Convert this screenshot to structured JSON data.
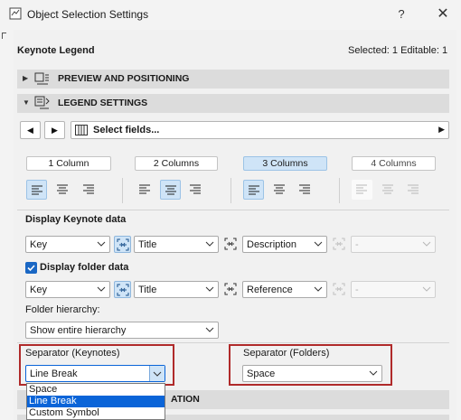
{
  "window": {
    "title": "Object Selection Settings",
    "help_label": "?",
    "close_label": "✕"
  },
  "header": {
    "object_name": "Keynote Legend",
    "selection_info": "Selected: 1 Editable: 1"
  },
  "sections": {
    "preview": "PREVIEW AND POSITIONING",
    "legend": "LEGEND SETTINGS",
    "hidden_partial": "ATION"
  },
  "toolbar": {
    "select_fields": "Select fields..."
  },
  "columns": {
    "one": "1 Column",
    "two": "2 Columns",
    "three": "3 Columns",
    "four": "4 Columns"
  },
  "keynote": {
    "heading": "Display Keynote data",
    "field1": "Key",
    "field2": "Title",
    "field3": "Description",
    "field4": "-"
  },
  "folder": {
    "checkbox_label": "Display folder data",
    "checked": true,
    "field1": "Key",
    "field2": "Title",
    "field3": "Reference",
    "field4": "-",
    "hierarchy_label": "Folder hierarchy:",
    "hierarchy_value": "Show entire hierarchy"
  },
  "separators": {
    "keynotes_label": "Separator (Keynotes)",
    "keynotes_value": "Line Break",
    "folders_label": "Separator (Folders)",
    "folders_value": "Space",
    "options": [
      "Space",
      "Line Break",
      "Custom Symbol"
    ]
  },
  "colors": {
    "accent": "#0a64d8",
    "selected_bg": "#cfe4f7",
    "highlight_border": "#b02a2a"
  }
}
